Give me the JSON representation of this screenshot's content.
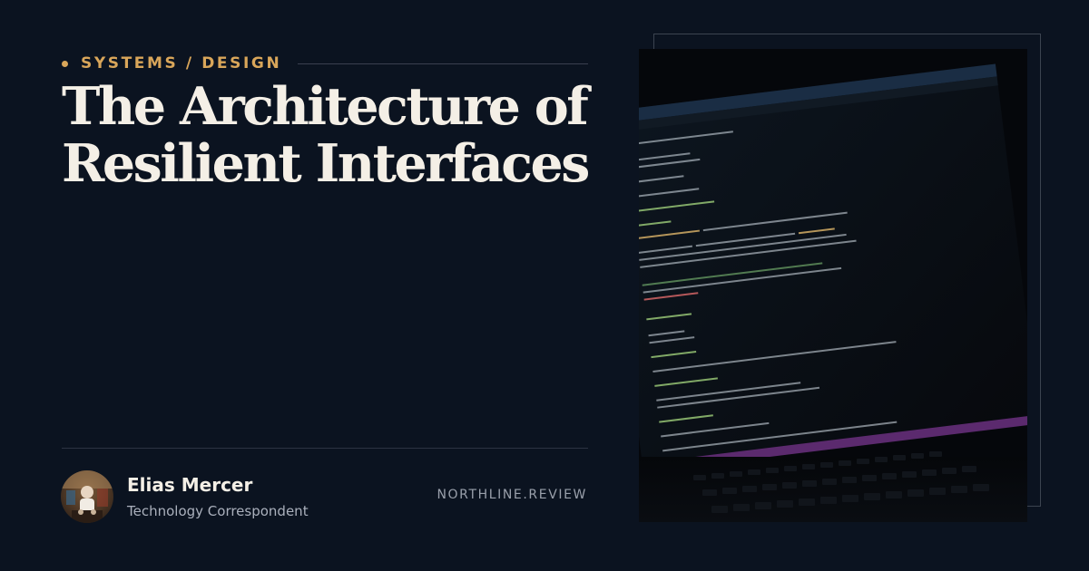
{
  "category": {
    "label": "SYSTEMS / DESIGN"
  },
  "headline": {
    "line1": "The Architecture of",
    "line2": "Resilient Interfaces"
  },
  "author": {
    "name": "Elias Mercer",
    "role": "Technology Correspondent"
  },
  "site": "NORTHLINE.REVIEW",
  "image": {
    "subject": "laptop screen showing code editor in dark room"
  },
  "colors": {
    "background": "#0b1320",
    "accent": "#d9a65a",
    "headline": "#f4efe6",
    "muted": "#aab0bc"
  }
}
